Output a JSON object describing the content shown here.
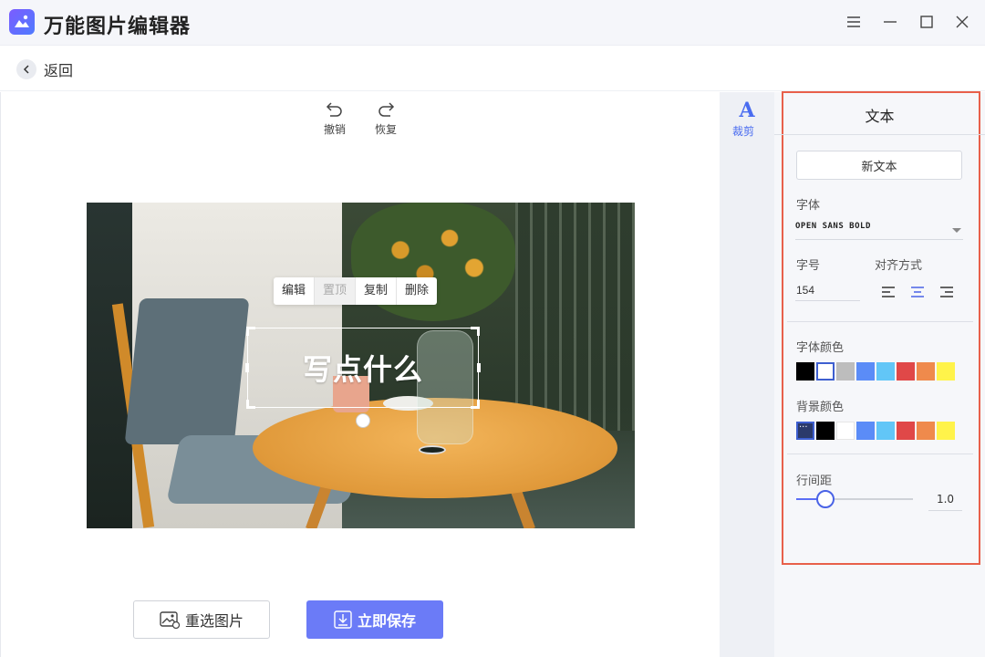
{
  "app": {
    "title": "万能图片编辑器"
  },
  "nav": {
    "back_label": "返回"
  },
  "toolbar": {
    "undo_label": "撤销",
    "redo_label": "恢复"
  },
  "context_menu": {
    "edit": "编辑",
    "bring_to_top": "置顶",
    "copy": "复制",
    "delete": "删除"
  },
  "canvas": {
    "text_content": "写点什么"
  },
  "actions": {
    "reselect_label": "重选图片",
    "save_label": "立即保存"
  },
  "tool_strip": {
    "crop_label": "裁剪"
  },
  "panel": {
    "title": "文本",
    "new_text_label": "新文本",
    "font_label": "字体",
    "font_value": "OPEN SANS BOLD",
    "size_label": "字号",
    "size_value": "154",
    "align_label": "对齐方式",
    "align_selected": "center",
    "font_color_label": "字体颜色",
    "font_colors": [
      "#000000",
      "#ffffff",
      "#bdbdbd",
      "#5b8cf7",
      "#62c6f7",
      "#e04848",
      "#ef8a4c",
      "#fff34a"
    ],
    "font_color_selected": 1,
    "bg_color_label": "背景颜色",
    "bg_colors": [
      "#2b3a6b",
      "#000000",
      "#ffffff",
      "#5b8cf7",
      "#62c6f7",
      "#e04848",
      "#ef8a4c",
      "#fff34a"
    ],
    "bg_color_selected": 0,
    "line_spacing_label": "行间距",
    "line_spacing_value": "1.0",
    "line_spacing_fraction": 0.25
  },
  "colors": {
    "accent": "#6b7bf7",
    "highlight_frame": "#e8604a"
  }
}
